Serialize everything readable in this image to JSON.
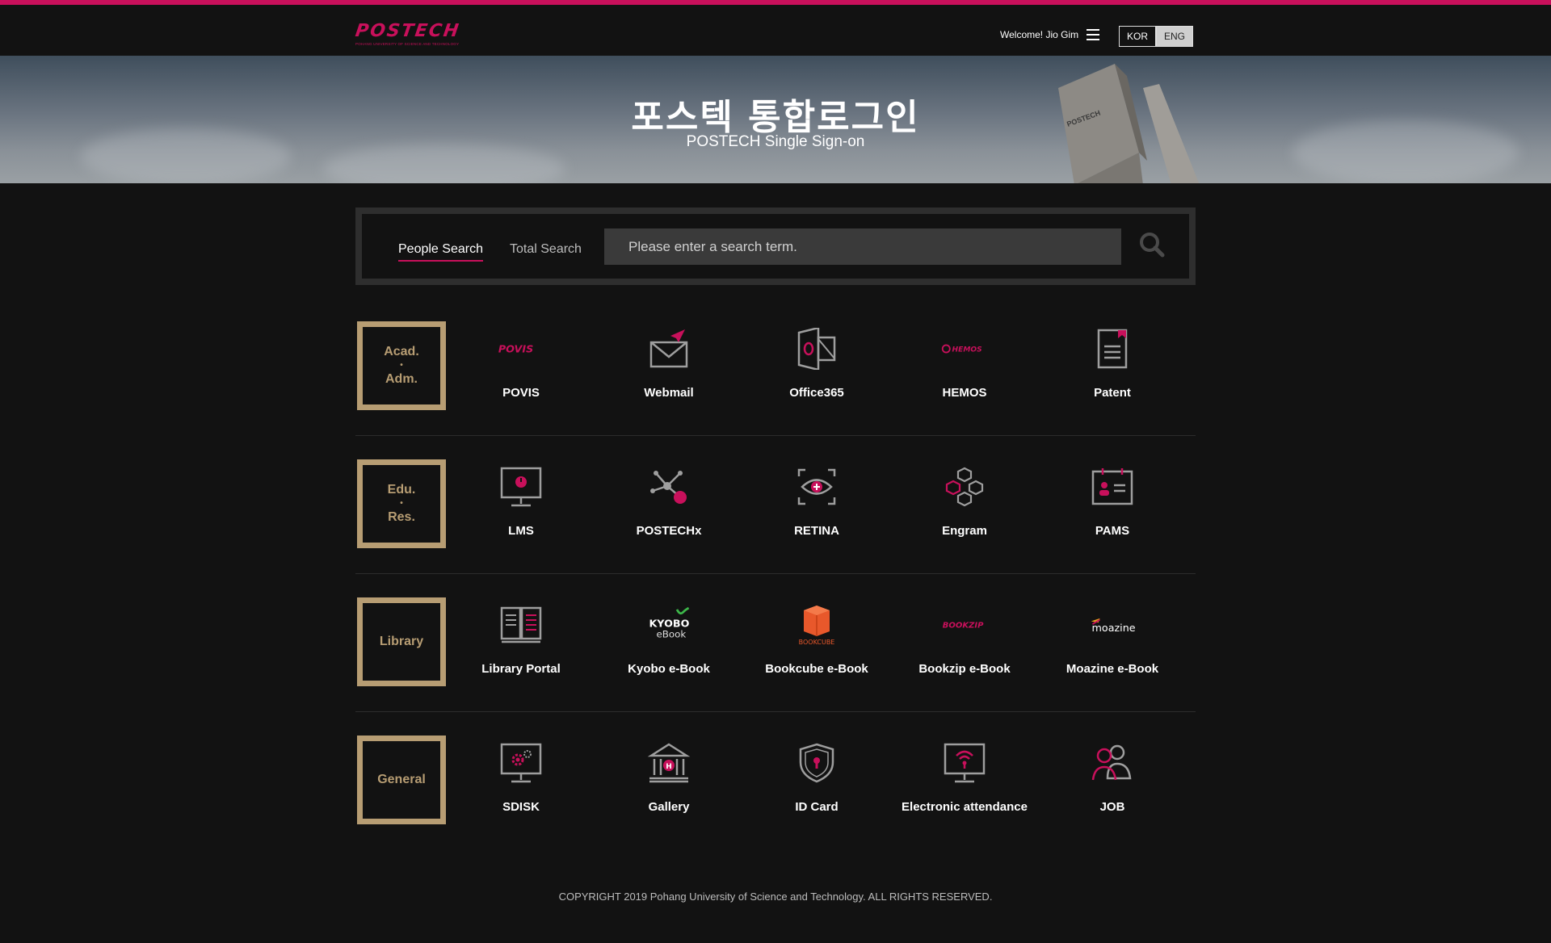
{
  "header": {
    "logo_text": "POSTECH",
    "logo_subtitle": "POHANG UNIVERSITY OF SCIENCE AND TECHNOLOGY",
    "welcome": "Welcome! Jio Gim",
    "lang_kor": "KOR",
    "lang_eng": "ENG",
    "selected_language": "ENG"
  },
  "hero": {
    "title": "포스텍 통합로그인",
    "subtitle": "POSTECH Single Sign-on"
  },
  "search": {
    "tabs": [
      "People Search",
      "Total Search"
    ],
    "active_tab": "People Search",
    "placeholder": "Please enter a search term.",
    "value": ""
  },
  "categories": [
    {
      "label_top": "Acad.",
      "label_bottom": "Adm.",
      "apps": [
        "POVIS",
        "Webmail",
        "Office365",
        "HEMOS",
        "Patent"
      ]
    },
    {
      "label_top": "Edu.",
      "label_bottom": "Res.",
      "apps": [
        "LMS",
        "POSTECHx",
        "RETINA",
        "Engram",
        "PAMS"
      ]
    },
    {
      "label": "Library",
      "apps": [
        "Library Portal",
        "Kyobo e-Book",
        "Bookcube e-Book",
        "Bookzip e-Book",
        "Moazine e-Book"
      ]
    },
    {
      "label": "General",
      "apps": [
        "SDISK",
        "Gallery",
        "ID Card",
        "Electronic attendance",
        "JOB"
      ]
    }
  ],
  "icon_text": {
    "povis": "POVIS",
    "hemos": "HEMOS",
    "kyobo_top": "KYOBO",
    "kyobo_bottom": "eBook",
    "bookcube": "BOOKCUBE",
    "bookzip": "BOOKZIP",
    "moazine": "moazine"
  },
  "icons": {
    "cat-0": [
      "povis-logo-icon",
      "envelope-icon",
      "office-icon",
      "hemos-logo-icon",
      "document-icon"
    ],
    "cat-1": [
      "monitor-icon",
      "network-icon",
      "eye-icon",
      "cubes-icon",
      "id-badge-icon"
    ],
    "cat-2": [
      "book-icon",
      "kyobo-logo-icon",
      "bookcube-logo-icon",
      "bookzip-logo-icon",
      "moazine-logo-icon"
    ],
    "cat-3": [
      "monitor-gear-icon",
      "building-icon",
      "shield-icon",
      "monitor-signal-icon",
      "people-icon"
    ]
  },
  "colors": {
    "accent": "#c8105b",
    "category_border": "#b79d73",
    "background": "#121212"
  },
  "footer": "COPYRIGHT 2019 Pohang University of Science and Technology. ALL RIGHTS RESERVED."
}
